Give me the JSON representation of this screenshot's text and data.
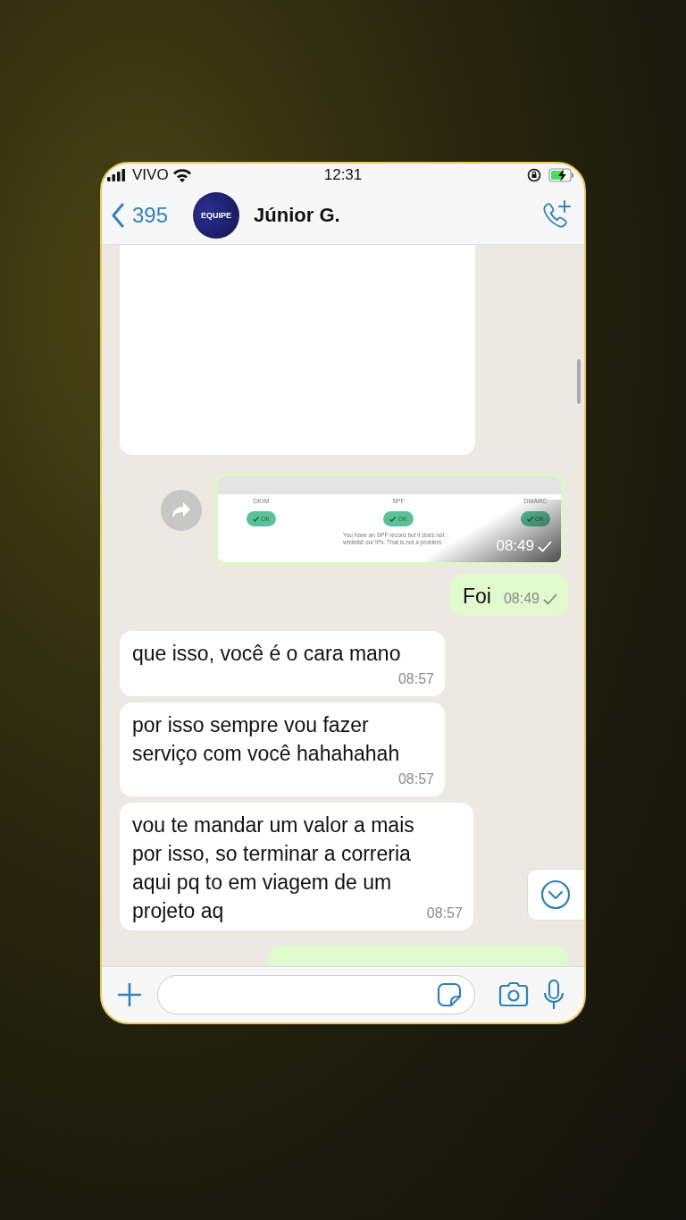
{
  "status_bar": {
    "carrier": "VIVO",
    "time": "12:31",
    "charging": true
  },
  "header": {
    "back_count": "395",
    "avatar_text": "EQUIPE",
    "contact_name": "Júnior G."
  },
  "messages": [
    {
      "kind": "blank-image",
      "sent": false
    },
    {
      "kind": "screenshot",
      "sent": true,
      "time": "08:49",
      "columns": [
        {
          "label": "DKIM",
          "badge": "OK"
        },
        {
          "label": "SPF",
          "badge": "OK"
        },
        {
          "label": "DMARC",
          "badge": "OK"
        }
      ],
      "note": "You have an SPF record but it does not\nwhitelist our IPs. That is not a problem."
    },
    {
      "kind": "text",
      "sent": true,
      "text": "Foi",
      "time": "08:49"
    },
    {
      "kind": "text",
      "sent": false,
      "text": "que isso, você é o cara mano",
      "time": "08:57"
    },
    {
      "kind": "text",
      "sent": false,
      "text": "por isso sempre vou fazer\nserviço com você hahahahah",
      "time": "08:57"
    },
    {
      "kind": "text",
      "sent": false,
      "text": "vou te mandar um valor a mais\npor isso, so terminar a correria\naqui pq to em viagem de um\nprojeto aq",
      "time": "08:57"
    },
    {
      "kind": "cut-off",
      "sent": true
    }
  ]
}
